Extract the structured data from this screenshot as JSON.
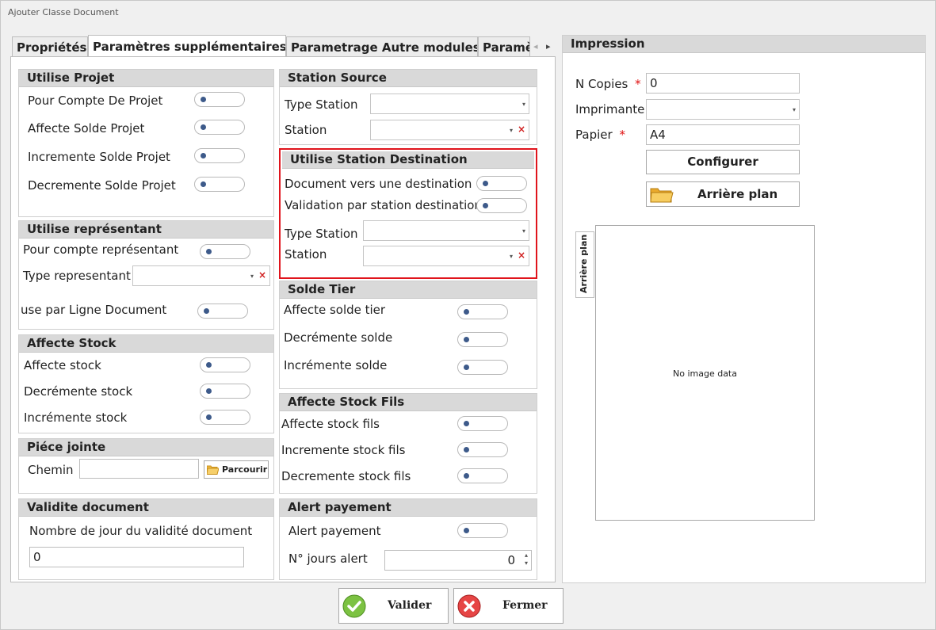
{
  "window": {
    "title": "Ajouter Classe Document"
  },
  "tabs": [
    "Propriétés",
    "Paramètres supplémentaires",
    "Parametrage Autre modules",
    "Paramè"
  ],
  "tab_nav": {
    "prev": "◂",
    "next": "▸"
  },
  "utilise_projet": {
    "title": "Utilise Projet",
    "items": [
      "Pour Compte De Projet",
      "Affecte Solde Projet",
      "Incremente Solde Projet",
      "Decremente Solde Projet"
    ]
  },
  "utilise_representant": {
    "title": "Utilise représentant",
    "pour_compte": "Pour compte représentant",
    "type_label": "Type representant",
    "par_ligne": "use par Ligne Document"
  },
  "affecte_stock": {
    "title": "Affecte Stock",
    "items": [
      "Affecte stock",
      "Decrémente stock",
      "Incrémente stock"
    ]
  },
  "piece_jointe": {
    "title": "Piéce jointe",
    "chemin_label": "Chemin",
    "chemin_value": "",
    "parcourir": "Parcourir"
  },
  "validite": {
    "title": "Validite document",
    "label": "Nombre de jour du validité document",
    "value": "0"
  },
  "station_source": {
    "title": "Station Source",
    "type_label": "Type Station",
    "station_label": "Station"
  },
  "station_dest": {
    "title": "Utilise Station Destination",
    "doc_vers": "Document vers une destination",
    "validation": "Validation par station destination",
    "type_label": "Type Station",
    "station_label": "Station"
  },
  "solde_tier": {
    "title": "Solde Tier",
    "items": [
      "Affecte solde tier",
      "Decrémente solde",
      "Incrémente solde"
    ]
  },
  "stock_fils": {
    "title": "Affecte Stock Fils",
    "items": [
      "Affecte stock fils",
      "Incremente stock fils",
      "Decremente stock fils"
    ]
  },
  "alert": {
    "title": "Alert payement",
    "alert_label": "Alert payement",
    "jours_label": "N° jours alert",
    "jours_value": "0"
  },
  "impression": {
    "title": "Impression",
    "copies_label": "N Copies",
    "copies_value": "0",
    "imprimante_label": "Imprimante",
    "papier_label": "Papier",
    "papier_value": "A4",
    "required_mark": "*",
    "configurer": "Configurer",
    "arriere_plan": "Arrière plan",
    "side_tab": "Arrière plan",
    "no_image": "No image data"
  },
  "footer": {
    "valider": "Valider",
    "fermer": "Fermer"
  }
}
